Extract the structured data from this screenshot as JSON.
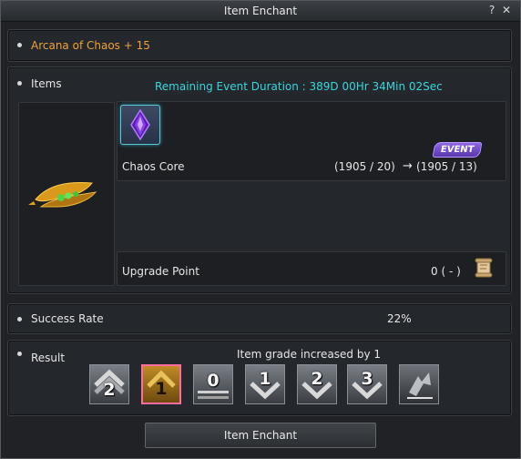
{
  "window": {
    "title": "Item Enchant",
    "help_label": "?",
    "close_label": "✕"
  },
  "item_name": "Arcana of Chaos + 15",
  "items_section": {
    "label": "Items",
    "event_duration": "Remaining Event Duration : 389D 00Hr 34Min 02Sec",
    "material": {
      "name": "Chaos Core",
      "current": "(1905 / 20)",
      "arrow": "→",
      "after": "(1905 / 13)",
      "event_badge": "EVENT"
    },
    "upgrade_point": {
      "label": "Upgrade Point",
      "value": "0 ( - )"
    }
  },
  "success_rate": {
    "label": "Success Rate",
    "value": "22%"
  },
  "result": {
    "label": "Result",
    "message": "Item grade increased by 1",
    "grades": [
      {
        "label": "2"
      },
      {
        "label": "1"
      },
      {
        "label": "0"
      },
      {
        "label": "1"
      },
      {
        "label": "2"
      },
      {
        "label": "3"
      },
      {
        "label": ""
      }
    ]
  },
  "enchant_button": "Item Enchant",
  "colors": {
    "item_name": "#f0a13a",
    "event_duration": "#3ad6dd",
    "selected_grade_border": "#ff6c9d",
    "event_badge": "#7b55d6"
  }
}
